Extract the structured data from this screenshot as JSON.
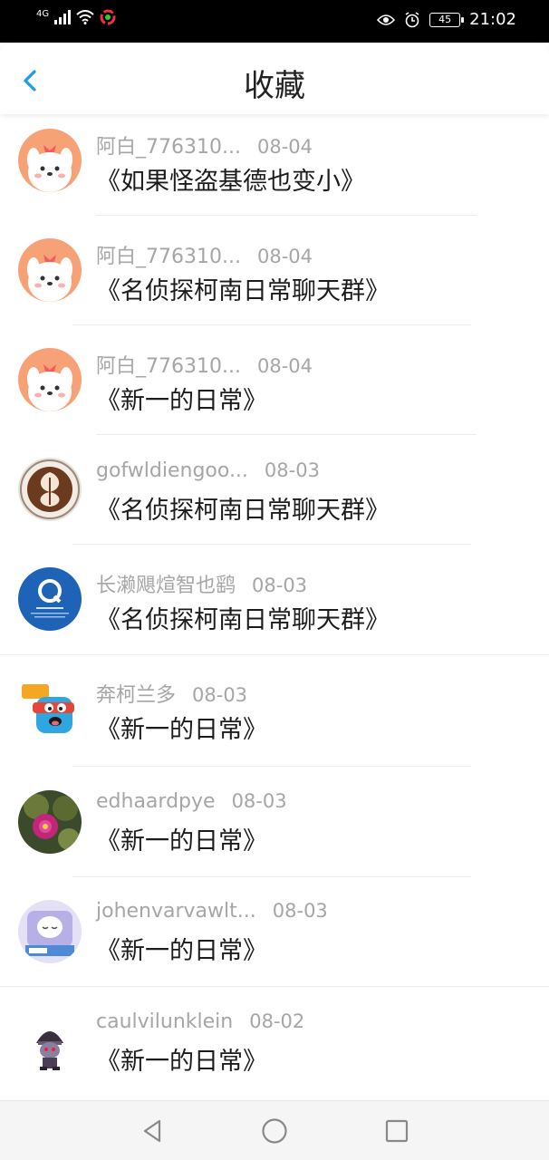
{
  "status_bar": {
    "network": "4G",
    "battery": "45",
    "time": "21:02",
    "icons": [
      "signal-icon",
      "wifi-icon",
      "app-notification-icon",
      "eye-comfort-icon",
      "alarm-icon",
      "battery-icon"
    ]
  },
  "header": {
    "title": "收藏",
    "back_icon": "chevron-left-icon",
    "accent_color": "#1a9cf0"
  },
  "favorites": [
    {
      "name": "阿白_776310...",
      "date": "08-04",
      "title": "《如果怪盗基德也变小》",
      "avatar": "puppy-avatar"
    },
    {
      "name": "阿白_776310...",
      "date": "08-04",
      "title": "《名侦探柯南日常聊天群》",
      "avatar": "puppy-avatar"
    },
    {
      "name": "阿白_776310...",
      "date": "08-04",
      "title": "《新一的日常》",
      "avatar": "puppy-avatar"
    },
    {
      "name": "gofwldiengoo...",
      "date": "08-03",
      "title": "《名侦探柯南日常聊天群》",
      "avatar": "latte-art-avatar"
    },
    {
      "name": "长濑飓煊智也鹞",
      "date": "08-03",
      "title": "《名侦探柯南日常聊天群》",
      "avatar": "blue-q-logo-avatar"
    },
    {
      "name": "奔柯兰多",
      "date": "08-03",
      "title": "《新一的日常》",
      "avatar": "cartoon-monster-avatar"
    },
    {
      "name": "edhaardpye",
      "date": "08-03",
      "title": "《新一的日常》",
      "avatar": "cactus-flower-avatar"
    },
    {
      "name": "johenvarvawlt...",
      "date": "08-03",
      "title": "《新一的日常》",
      "avatar": "sleeping-cartoon-avatar"
    },
    {
      "name": "caulvilunklein",
      "date": "08-02",
      "title": "《新一的日常》",
      "avatar": "hooded-figure-avatar"
    }
  ],
  "nav_bar": {
    "buttons": [
      "back-triangle-icon",
      "home-circle-icon",
      "recents-square-icon"
    ]
  }
}
